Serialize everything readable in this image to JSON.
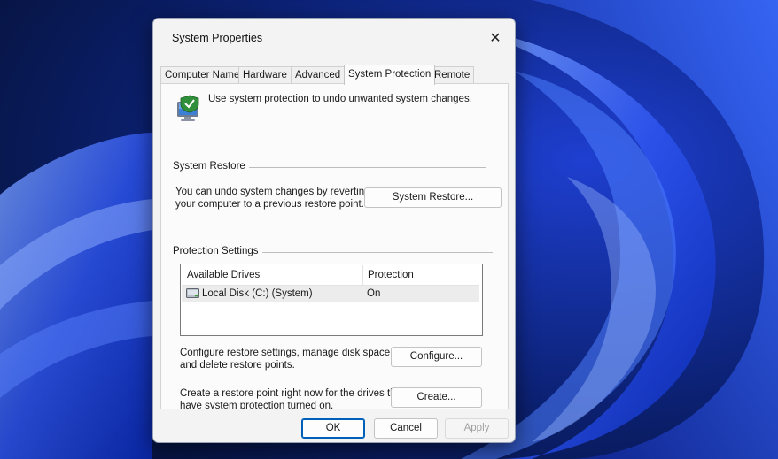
{
  "window": {
    "title": "System Properties"
  },
  "tabs": [
    {
      "label": "Computer Name"
    },
    {
      "label": "Hardware"
    },
    {
      "label": "Advanced"
    },
    {
      "label": "System Protection"
    },
    {
      "label": "Remote"
    }
  ],
  "active_tab": "System Protection",
  "intro": {
    "text": "Use system protection to undo unwanted system changes.",
    "icon": "system-protection-icon"
  },
  "system_restore": {
    "group_label": "System Restore",
    "description_line1": "You can undo system changes by reverting",
    "description_line2": "your computer to a previous restore point.",
    "button_label": "System Restore..."
  },
  "protection_settings": {
    "group_label": "Protection Settings",
    "columns": [
      "Available Drives",
      "Protection"
    ],
    "rows": [
      {
        "drive": "Local Disk  (C:) (System)",
        "protection": "On",
        "icon": "drive-icon"
      }
    ],
    "configure_text_line1": "Configure restore settings, manage disk space,",
    "configure_text_line2": "and delete restore points.",
    "configure_button": "Configure...",
    "create_text_line1": "Create a restore point right now for the drives that",
    "create_text_line2": "have system protection turned on.",
    "create_button": "Create..."
  },
  "footer": {
    "ok": "OK",
    "cancel": "Cancel",
    "apply": "Apply"
  },
  "colors": {
    "accent": "#005fb8",
    "wallpaper": "#0a2a9a"
  }
}
